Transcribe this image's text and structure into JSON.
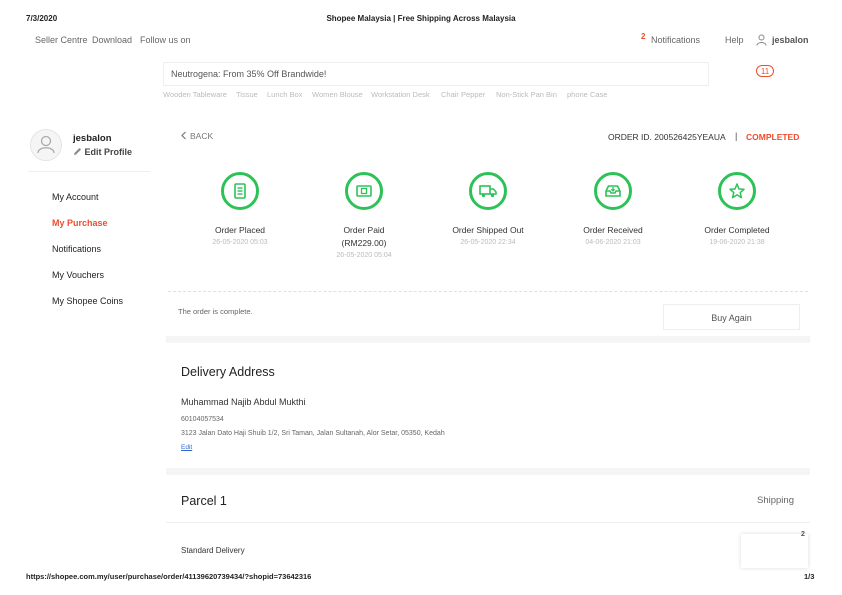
{
  "print": {
    "date": "7/3/2020",
    "title": "Shopee Malaysia | Free Shipping Across Malaysia",
    "url": "https://shopee.com.my/user/purchase/order/41139620739434/?shopid=73642316",
    "page": "1/3"
  },
  "topnav": {
    "seller_centre": "Seller Centre",
    "download": "Download",
    "follow_us": "Follow us on",
    "notification_count": "2",
    "notifications": "Notifications",
    "help": "Help",
    "username": "jesbalon"
  },
  "search": {
    "placeholder": "Neutrogena: From 35% Off Brandwide!",
    "suggestions": [
      "Wooden Tableware",
      "Tissue",
      "Lunch Box",
      "Women Blouse",
      "Workstation Desk",
      "Chair Pepper",
      "Non-Stick Pan Bin",
      "phone Case"
    ],
    "cart_count": "11"
  },
  "sidebar": {
    "username": "jesbalon",
    "edit_profile": "Edit Profile",
    "items": [
      {
        "label": "My Account",
        "active": false
      },
      {
        "label": "My Purchase",
        "active": true
      },
      {
        "label": "Notifications",
        "active": false
      },
      {
        "label": "My Vouchers",
        "active": false
      },
      {
        "label": "My Shopee Coins",
        "active": false
      }
    ]
  },
  "order": {
    "back": "BACK",
    "order_id": "ORDER ID. 200526425YEAUA",
    "separator": "|",
    "status": "COMPLETED",
    "status_color": "#ee4d2d",
    "step_color": "#2dc258",
    "steps": [
      {
        "label": "Order Placed",
        "sub": "",
        "time": "26-05-2020 05:03",
        "icon": "receipt-icon"
      },
      {
        "label": "Order Paid",
        "sub": "(RM229.00)",
        "time": "26-05-2020 05:04",
        "icon": "payment-icon"
      },
      {
        "label": "Order Shipped Out",
        "sub": "",
        "time": "26-05-2020 22:34",
        "icon": "truck-icon"
      },
      {
        "label": "Order Received",
        "sub": "",
        "time": "04-06-2020 21:03",
        "icon": "inbox-icon"
      },
      {
        "label": "Order Completed",
        "sub": "",
        "time": "19-06-2020 21:38",
        "icon": "star-icon"
      }
    ],
    "complete_message": "The order is complete.",
    "buy_again": "Buy Again"
  },
  "delivery": {
    "title": "Delivery Address",
    "name": "Muhammad Najib Abdul Mukthi",
    "phone": "60104057534",
    "address": "3123 Jalan Dato Haji Shuib 1/2, Sri Taman, Jalan Sultanah, Alor Setar, 05350, Kedah",
    "edit": "Edit"
  },
  "parcel": {
    "title": "Parcel 1",
    "status": "Shipping",
    "delivery_type": "Standard Delivery",
    "chat_count": "2"
  }
}
